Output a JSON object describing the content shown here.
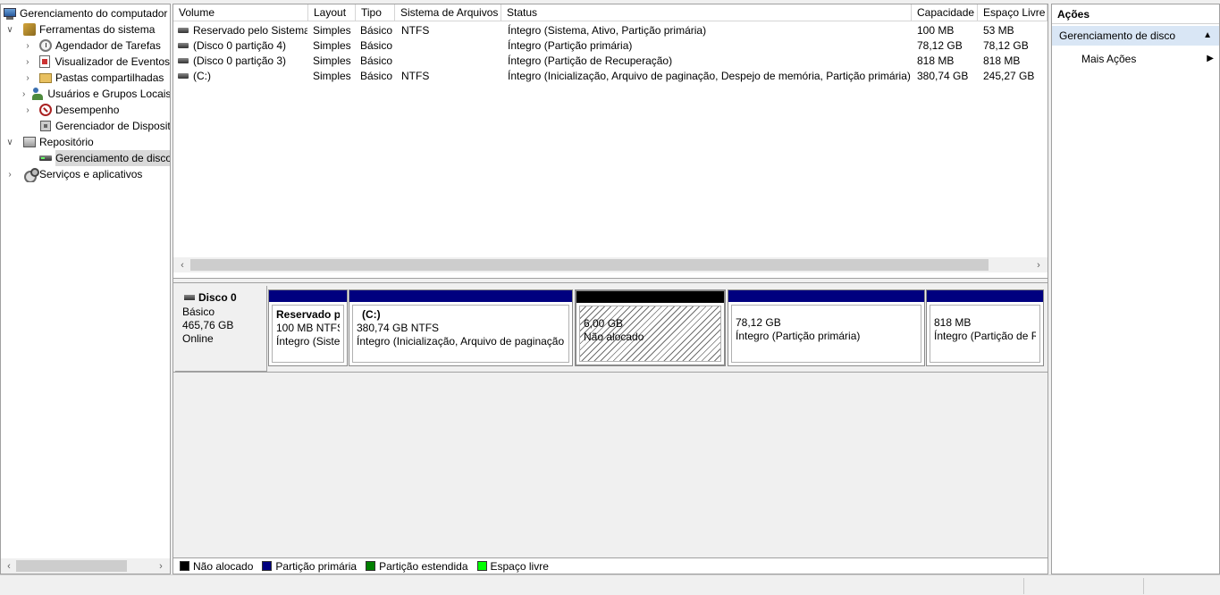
{
  "tree": {
    "root": "Gerenciamento do computador (Local)",
    "items": [
      {
        "label": "Ferramentas do sistema",
        "icon": "tools-icon"
      },
      {
        "label": "Agendador de Tarefas",
        "icon": "clock-icon"
      },
      {
        "label": "Visualizador de Eventos",
        "icon": "event-viewer-icon"
      },
      {
        "label": "Pastas compartilhadas",
        "icon": "shared-folder-icon"
      },
      {
        "label": "Usuários e Grupos Locais",
        "icon": "users-icon"
      },
      {
        "label": "Desempenho",
        "icon": "performance-icon"
      },
      {
        "label": "Gerenciador de Dispositivos",
        "icon": "device-manager-icon"
      },
      {
        "label": "Repositório",
        "icon": "storage-icon"
      },
      {
        "label": "Gerenciamento de disco",
        "icon": "disk-icon"
      },
      {
        "label": "Serviços e aplicativos",
        "icon": "services-icon"
      }
    ]
  },
  "volumes": {
    "headers": [
      "Volume",
      "Layout",
      "Tipo",
      "Sistema de Arquivos",
      "Status",
      "Capacidade",
      "Espaço Livre"
    ],
    "rows": [
      [
        "Reservado pelo Sistema",
        "Simples",
        "Básico",
        "NTFS",
        "Íntegro (Sistema, Ativo, Partição primária)",
        "100 MB",
        "53 MB"
      ],
      [
        "(Disco 0 partição 4)",
        "Simples",
        "Básico",
        "",
        "Íntegro (Partição primária)",
        "78,12 GB",
        "78,12 GB"
      ],
      [
        "(Disco 0 partição 3)",
        "Simples",
        "Básico",
        "",
        "Íntegro (Partição de Recuperação)",
        "818 MB",
        "818 MB"
      ],
      [
        "(C:)",
        "Simples",
        "Básico",
        "NTFS",
        "Íntegro (Inicialização, Arquivo de paginação, Despejo de memória, Partição primária)",
        "380,74 GB",
        "245,27 GB"
      ]
    ]
  },
  "disk": {
    "name": "Disco 0",
    "type": "Básico",
    "size": "465,76 GB",
    "state": "Online",
    "partitions": [
      {
        "title": "Reservado pelo Sistema",
        "size": "100 MB NTFS",
        "status": "Íntegro (Sistema, Ativo, Partição primária)",
        "bar_color": "#00007f"
      },
      {
        "title": "(C:)",
        "size": "380,74 GB NTFS",
        "status": "Íntegro (Inicialização, Arquivo de paginação, Despejo de memória, Partição primária)",
        "bar_color": "#00007f"
      },
      {
        "title": "",
        "size": "6,00 GB",
        "status": "Não alocado",
        "bar_color": "#000000"
      },
      {
        "title": "",
        "size": "78,12 GB",
        "status": "Íntegro (Partição primária)",
        "bar_color": "#00007f"
      },
      {
        "title": "",
        "size": "818 MB",
        "status": "Íntegro (Partição de Recuperação)",
        "bar_color": "#00007f"
      }
    ]
  },
  "legend": [
    {
      "label": "Não alocado",
      "color": "#000000"
    },
    {
      "label": "Partição primária",
      "color": "#00007f"
    },
    {
      "label": "Partição estendida",
      "color": "#007f00"
    },
    {
      "label": "Espaço livre",
      "color": "#00ff00"
    }
  ],
  "actions": {
    "title": "Ações",
    "section": "Gerenciamento de disco",
    "more": "Mais Ações"
  }
}
